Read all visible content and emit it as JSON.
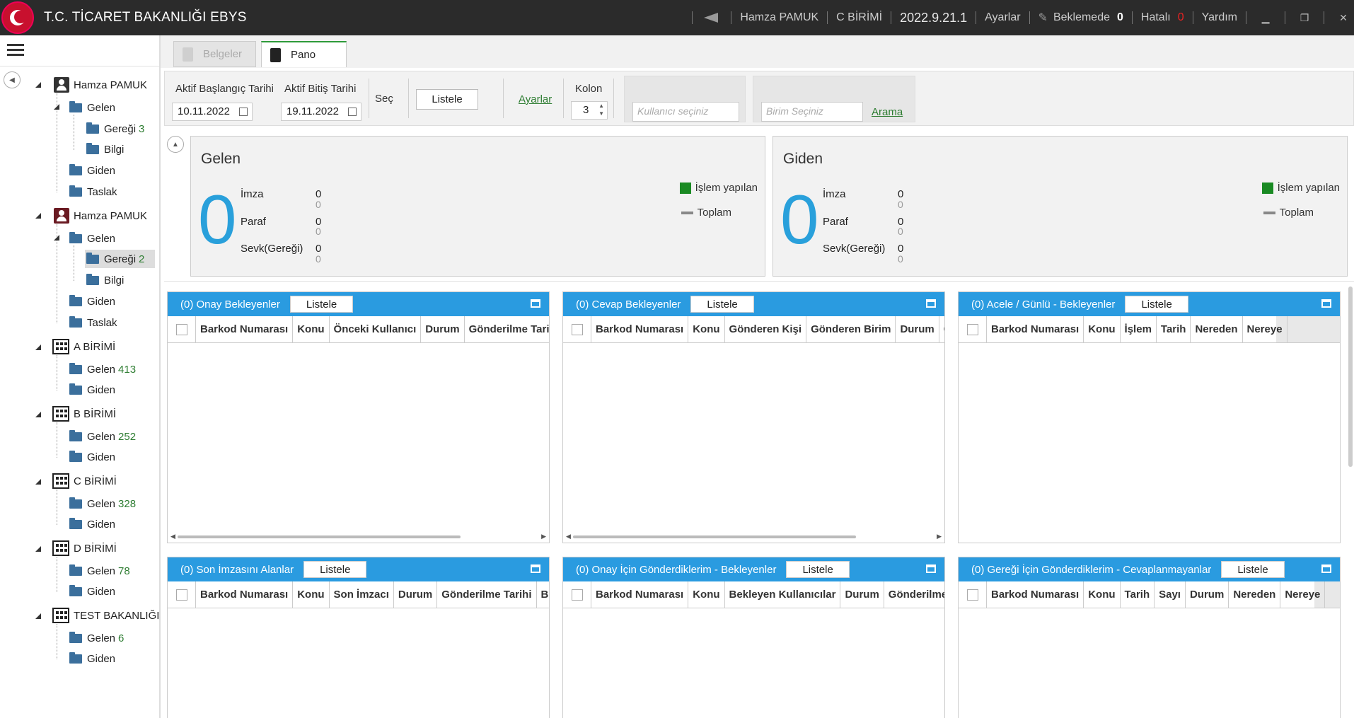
{
  "titlebar": {
    "app_title": "T.C. TİCARET BAKANLIĞI EBYS",
    "user": "Hamza PAMUK",
    "unit": "C BİRİMİ",
    "version": "2022.9.21.1",
    "settings": "Ayarlar",
    "pending_label": "Beklemede",
    "pending_count": "0",
    "error_label": "Hatalı",
    "error_count": "0",
    "help": "Yardım",
    "minimize": "▁",
    "restore": "❐",
    "close": "✕"
  },
  "tree": {
    "users": [
      {
        "name": "Hamza PAMUK",
        "gelen": "Gelen",
        "geregi": "Gereği",
        "geregi_count": "3",
        "bilgi": "Bilgi",
        "giden": "Giden",
        "taslak": "Taslak"
      },
      {
        "name": "Hamza PAMUK",
        "gelen": "Gelen",
        "geregi": "Gereği",
        "geregi_count": "2",
        "bilgi": "Bilgi",
        "giden": "Giden",
        "taslak": "Taslak"
      }
    ],
    "units": [
      {
        "name": "A BİRİMİ",
        "gelen": "Gelen",
        "count": "413",
        "giden": "Giden"
      },
      {
        "name": "B BİRİMİ",
        "gelen": "Gelen",
        "count": "252",
        "giden": "Giden"
      },
      {
        "name": "C BİRİMİ",
        "gelen": "Gelen",
        "count": "328",
        "giden": "Giden"
      },
      {
        "name": "D BİRİMİ",
        "gelen": "Gelen",
        "count": "78",
        "giden": "Giden"
      },
      {
        "name": "TEST BAKANLIĞI",
        "gelen": "Gelen",
        "count": "6",
        "giden": "Giden"
      }
    ]
  },
  "tabs": {
    "belgeler": "Belgeler",
    "pano": "Pano"
  },
  "filters": {
    "start_label": "Aktif Başlangıç Tarihi",
    "start_value": "10.11.2022",
    "end_label": "Aktif Bitiş Tarihi",
    "end_value": "19.11.2022",
    "sec": "Seç",
    "listele": "Listele",
    "ayarlar": "Ayarlar",
    "kolon_label": "Kolon",
    "kolon_value": "3",
    "user_placeholder": "Kullanıcı seçiniz",
    "unit_placeholder": "Birim Seçiniz",
    "arama": "Arama"
  },
  "summary": {
    "gelen": {
      "title": "Gelen",
      "total": "0",
      "rows": [
        {
          "label": "İmza",
          "value": "0",
          "sub": "0"
        },
        {
          "label": "Paraf",
          "value": "0",
          "sub": "0"
        },
        {
          "label": "Sevk(Gereği)",
          "value": "0",
          "sub": "0"
        }
      ],
      "legend_done": "İşlem yapılan",
      "legend_total": "Toplam"
    },
    "giden": {
      "title": "Giden",
      "total": "0",
      "rows": [
        {
          "label": "İmza",
          "value": "0",
          "sub": "0"
        },
        {
          "label": "Paraf",
          "value": "0",
          "sub": "0"
        },
        {
          "label": "Sevk(Gereği)",
          "value": "0",
          "sub": "0"
        }
      ],
      "legend_done": "İşlem yapılan",
      "legend_total": "Toplam"
    }
  },
  "colors": {
    "accent": "#2a9be0",
    "green": "#1a8a23",
    "titlebar": "#2b2b2b",
    "link": "#2e7d32"
  },
  "widgets": [
    {
      "title": "(0) Onay Bekleyenler",
      "button": "Listele",
      "columns": [
        "Barkod Numarası",
        "Konu",
        "Önceki Kullanıcı",
        "Durum",
        "Gönderilme Tarihi"
      ]
    },
    {
      "title": "(0) Cevap Bekleyenler",
      "button": "Listele",
      "columns": [
        "Barkod Numarası",
        "Konu",
        "Gönderen Kişi",
        "Gönderen Birim",
        "Durum",
        "Gö"
      ]
    },
    {
      "title": "(0) Acele / Günlü - Bekleyenler",
      "button": "Listele",
      "columns": [
        "Barkod Numarası",
        "Konu",
        "İşlem",
        "Tarih",
        "Nereden",
        "Nereye"
      ]
    },
    {
      "title": "(0) Son İmzasını Alanlar",
      "button": "Listele",
      "columns": [
        "Barkod Numarası",
        "Konu",
        "Son İmzacı",
        "Durum",
        "Gönderilme Tarihi",
        "Belg"
      ]
    },
    {
      "title": "(0) Onay İçin Gönderdiklerim - Bekleyenler",
      "button": "Listele",
      "columns": [
        "Barkod Numarası",
        "Konu",
        "Bekleyen Kullanıcılar",
        "Durum",
        "Gönderilme T"
      ]
    },
    {
      "title": "(0) Gereği İçin Gönderdiklerim - Cevaplanmayanlar",
      "button": "Listele",
      "columns": [
        "Barkod Numarası",
        "Konu",
        "Tarih",
        "Sayı",
        "Durum",
        "Nereden",
        "Nereye"
      ]
    }
  ]
}
